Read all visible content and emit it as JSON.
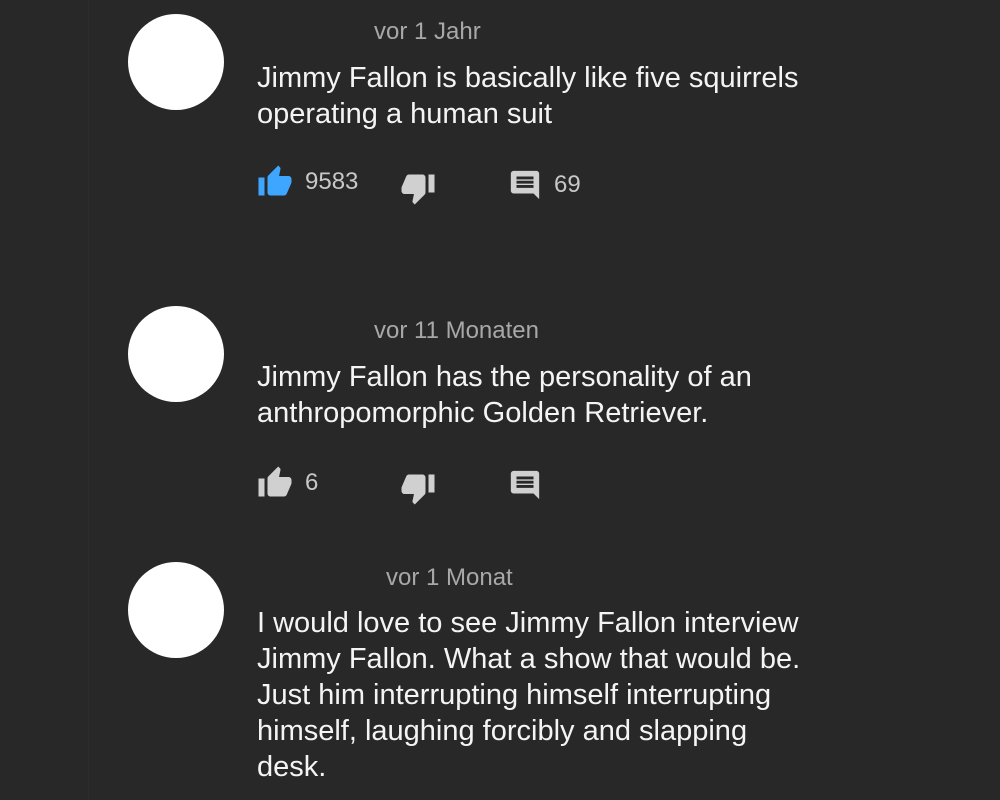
{
  "comments": [
    {
      "timestamp": "vor 1 Jahr",
      "lines": [
        "Jimmy Fallon is basically like five squirrels",
        "operating a human suit"
      ],
      "likes": "9583",
      "liked": true,
      "replies": "69"
    },
    {
      "timestamp": "vor 11 Monaten",
      "lines": [
        "Jimmy Fallon has the personality of an",
        "anthropomorphic Golden Retriever."
      ],
      "likes": "6",
      "liked": false,
      "replies": ""
    },
    {
      "timestamp": "vor 1 Monat",
      "lines": [
        "I would love to see Jimmy Fallon interview",
        "Jimmy Fallon. What a show that would be.",
        "Just him interrupting himself interrupting",
        "himself, laughing forcibly and slapping",
        "desk."
      ]
    }
  ],
  "icons": {
    "like": "thumbs-up-icon",
    "dislike": "thumbs-down-icon",
    "reply": "comment-icon"
  },
  "colors": {
    "background": "#282828",
    "like_active": "#3ea6ff",
    "icon_default": "#d0d0d0",
    "avatar": "#ffffff"
  }
}
